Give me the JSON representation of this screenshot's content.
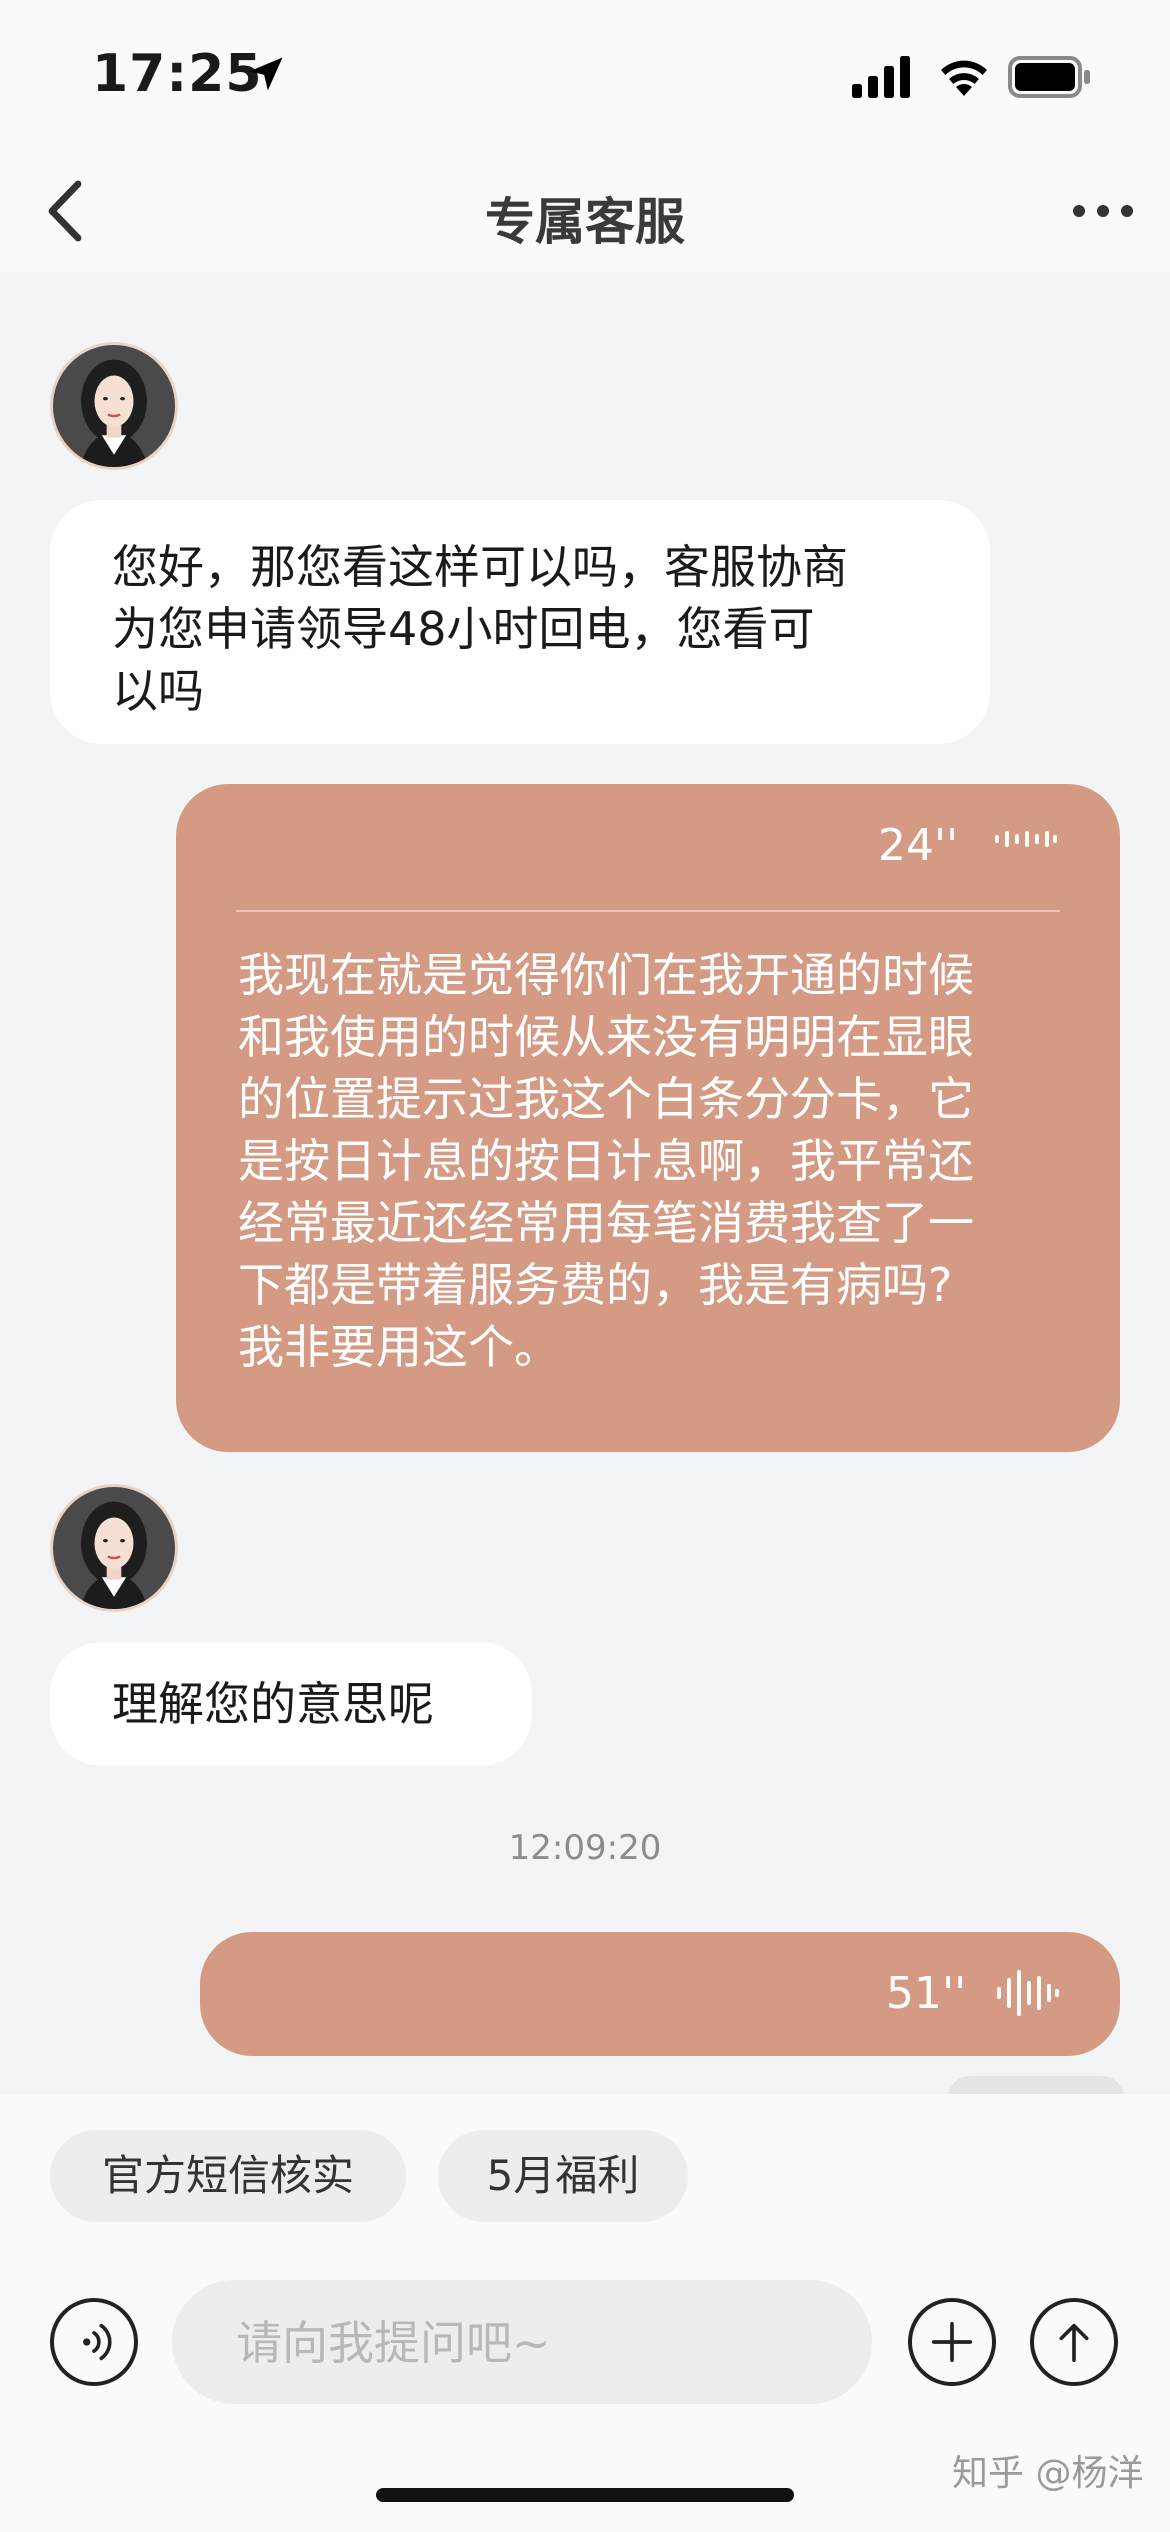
{
  "status_bar": {
    "time": "17:25",
    "icons": [
      "location-arrow-icon",
      "cellular-signal-icon",
      "wifi-icon",
      "battery-icon"
    ]
  },
  "nav": {
    "title": "专属客服",
    "back_icon": "chevron-left-icon",
    "more_icon": "more-dots-icon"
  },
  "messages": [
    {
      "from": "agent",
      "type": "text",
      "lines": [
        "您好，那您看这样可以吗，客服协商",
        "为您申请领导48小时回电，您看可",
        "以吗"
      ]
    },
    {
      "from": "user",
      "type": "voice",
      "duration": "24''",
      "transcript_lines": [
        "我现在就是觉得你们在我开通的时候",
        "和我使用的时候从来没有明明在显眼",
        "的位置提示过我这个白条分分卡，它",
        "是按日计息的按日计息啊，我平常还",
        "经常最近还经常用每笔消费我查了一",
        "下都是带着服务费的，我是有病吗?",
        "我非要用这个。"
      ]
    },
    {
      "from": "agent",
      "type": "text",
      "lines": [
        "理解您的意思呢"
      ]
    },
    {
      "type": "timestamp",
      "text": "12:09:20"
    },
    {
      "from": "user",
      "type": "voice",
      "duration": "51''"
    }
  ],
  "quick_replies": [
    "官方短信核实",
    "5月福利"
  ],
  "composer": {
    "placeholder": "请向我提问吧~",
    "voice_icon": "voice-input-icon",
    "plus_icon": "plus-icon",
    "send_icon": "send-up-arrow-icon"
  },
  "watermark": "知乎 @杨洋",
  "colors": {
    "user_bubble": "#d59a84",
    "agent_bubble": "#ffffff",
    "chat_background": "#f3f4f6"
  }
}
